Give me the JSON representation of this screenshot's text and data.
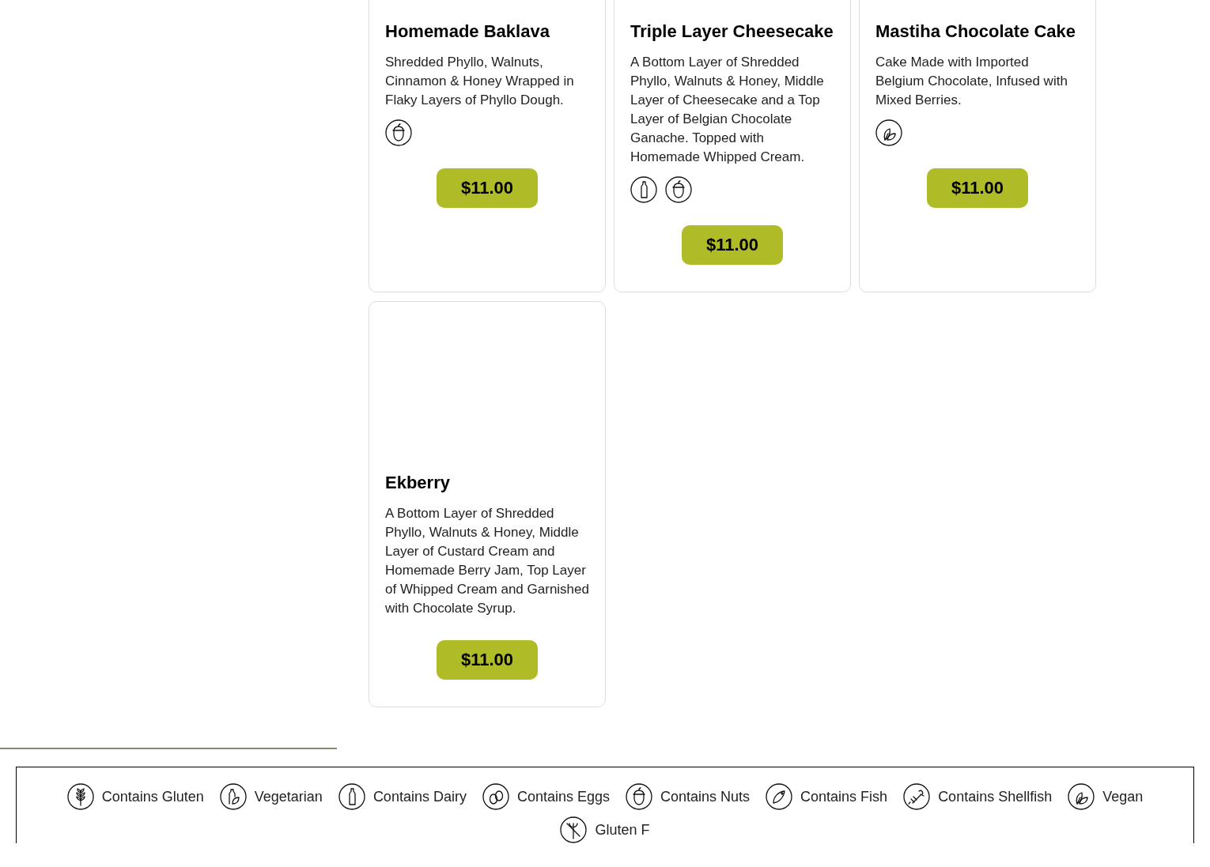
{
  "menu_items": [
    {
      "title": "Homemade Baklava",
      "description": "Shredded Phyllo, Walnuts, Cinnamon & Honey Wrapped in Flaky Layers of Phyllo Dough.",
      "allergens": [
        {
          "kind": "nuts"
        }
      ],
      "price": "$11.00"
    },
    {
      "title": "Triple Layer Cheesecake",
      "description": "A Bottom Layer of Shredded Phyllo, Walnuts & Honey, Middle Layer of Cheesecake and a Top Layer of Belgian Chocolate Ganache. Topped with Homemade Whipped Cream.",
      "allergens": [
        {
          "kind": "dairy"
        },
        {
          "kind": "nuts"
        }
      ],
      "price": "$11.00"
    },
    {
      "title": "Mastiha Chocolate Cake",
      "description": "Cake Made with Imported Belgium Chocolate, Infused with Mixed Berries.",
      "allergens": [
        {
          "kind": "vegan"
        }
      ],
      "price": "$11.00"
    },
    {
      "title": "Ekberry",
      "description": "A Bottom Layer of Shredded Phyllo, Walnuts & Honey, Middle Layer of Custard Cream and Homemade Berry Jam, Top Layer of Whipped Cream and Garnished with Chocolate Syrup.",
      "price": "$11.00"
    }
  ],
  "legend": [
    {
      "kind": "gluten",
      "label": "Contains Gluten"
    },
    {
      "kind": "vegetarian",
      "label": "Vegetarian"
    },
    {
      "kind": "dairy",
      "label": "Contains Dairy"
    },
    {
      "kind": "eggs",
      "label": "Contains Eggs"
    },
    {
      "kind": "nuts",
      "label": "Contains Nuts"
    },
    {
      "kind": "fish",
      "label": "Contains Fish"
    },
    {
      "kind": "shellfish",
      "label": "Contains Shellfish"
    },
    {
      "kind": "vegan",
      "label": "Vegan"
    },
    {
      "kind": "glutenfree",
      "label": "Gluten F"
    }
  ]
}
